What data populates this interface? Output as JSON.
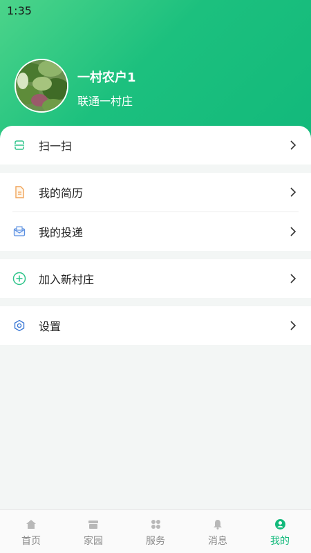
{
  "status_bar": {
    "time": "1:35"
  },
  "profile": {
    "name": "一村农户1",
    "village": "联通一村庄"
  },
  "menu": {
    "scan": "扫一扫",
    "resume": "我的简历",
    "delivery": "我的投递",
    "join_village": "加入新村庄",
    "settings": "设置"
  },
  "tabbar": {
    "tabs": [
      {
        "label": "首页",
        "icon": "home-icon"
      },
      {
        "label": "家园",
        "icon": "store-icon"
      },
      {
        "label": "服务",
        "icon": "grid-icon"
      },
      {
        "label": "消息",
        "icon": "bell-icon"
      },
      {
        "label": "我的",
        "icon": "user-icon"
      }
    ],
    "active_index": 4
  },
  "colors": {
    "accent": "#12b97b",
    "header_gradient_start": "#4cd48a",
    "header_gradient_end": "#12b97b",
    "resume_icon": "#f0a45a",
    "delivery_icon": "#5a8fe0",
    "settings_icon": "#3d7ad6"
  }
}
